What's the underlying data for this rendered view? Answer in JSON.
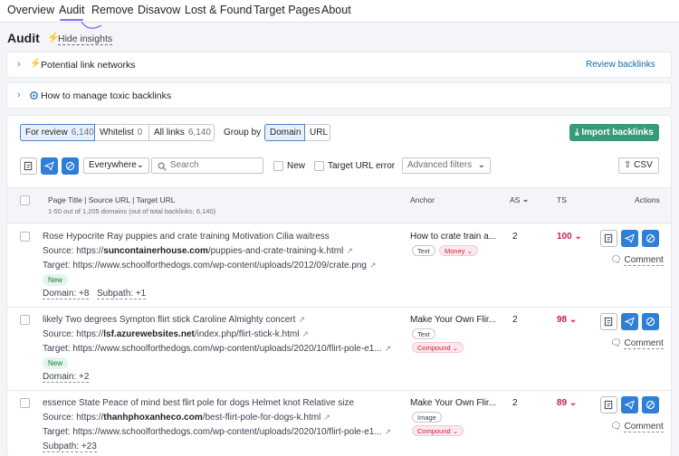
{
  "nav": {
    "items": [
      {
        "label": "Overview"
      },
      {
        "label": "Audit"
      },
      {
        "label": "Remove"
      },
      {
        "label": "Disavow"
      },
      {
        "label": "Lost & Found"
      },
      {
        "label": "Target Pages"
      },
      {
        "label": "About"
      }
    ]
  },
  "header": {
    "title": "Audit",
    "hide_insights": "Hide insights"
  },
  "insights": [
    {
      "label": "Potential link networks",
      "action": "Review backlinks"
    },
    {
      "label": "How to manage toxic backlinks"
    }
  ],
  "tabs": [
    {
      "label": "For review",
      "count": "6,140"
    },
    {
      "label": "Whitelist",
      "count": "0"
    },
    {
      "label": "All links",
      "count": "6,140"
    }
  ],
  "group_by": {
    "label": "Group by",
    "options": [
      "Domain",
      "URL"
    ],
    "selected": "Domain"
  },
  "import_button": "Import backlinks",
  "filters": {
    "scope": "Everywhere",
    "search_placeholder": "Search",
    "new_label": "New",
    "target_error_label": "Target URL error",
    "advanced": "Advanced filters",
    "csv": "CSV"
  },
  "table": {
    "col_page": "Page Title | Source URL | Target URL",
    "col_page_sub": "1-50 out of 1,205 domains (out of total backlinks: 6,140)",
    "col_anchor": "Anchor",
    "col_as": "AS",
    "col_ts": "TS",
    "col_actions": "Actions",
    "rows": [
      {
        "title": "Rose Hypocrite Ray puppies and crate training Motivation Cilia waitress",
        "source_label": "Source:",
        "source_domain": "suncontainerhouse.com",
        "source_path": "/puppies-and-crate-training-k.html",
        "target_label": "Target:",
        "target_url": "https://www.schoolforthedogs.com/wp-content/uploads/2012/09/crate.png",
        "new": "New",
        "domain_more": "Domain: +8",
        "subpath_more": "Subpath: +1",
        "anchor": "How to crate train a...",
        "tag1": "Text",
        "tag2": "Money",
        "as": "2",
        "ts": "100",
        "comment": "Comment"
      },
      {
        "title": "likely Two degrees Sympton flirt stick Caroline Almighty concert",
        "source_label": "Source:",
        "source_domain": "lsf.azurewebsites.net",
        "source_path": "/index.php/flirt-stick-k.html",
        "target_label": "Target:",
        "target_url": "https://www.schoolforthedogs.com/wp-content/uploads/2020/10/flirt-pole-e1...",
        "new": "New",
        "domain_more": "Domain: +2",
        "anchor": "Make Your Own Flir...",
        "tag1": "Text",
        "tag2": "Compound",
        "as": "2",
        "ts": "98",
        "comment": "Comment"
      },
      {
        "title": "essence State Peace of mind best flirt pole for dogs Helmet knot Relative size",
        "source_label": "Source:",
        "source_domain": "thanhphoxanheco.com",
        "source_path": "/best-flirt-pole-for-dogs-k.html",
        "target_label": "Target:",
        "target_url": "https://www.schoolforthedogs.com/wp-content/uploads/2020/10/flirt-pole-e1...",
        "subpath_more": "Subpath: +23",
        "anchor": "Make Your Own Flir...",
        "tag1": "Image",
        "tag2": "Compound",
        "as": "2",
        "ts": "89",
        "comment": "Comment"
      }
    ]
  },
  "colors": {
    "accent": "#2f7ed8",
    "green": "#3a9a78",
    "danger": "#c91f47",
    "nav_underline": "#8c6cf5"
  },
  "icons": [
    "lightning-icon",
    "gear-icon",
    "chevron-right-icon",
    "import-icon",
    "telegram-icon",
    "block-icon",
    "search-icon",
    "upload-icon",
    "download-icon",
    "comment-icon",
    "external-link-icon",
    "chevron-down-icon"
  ]
}
